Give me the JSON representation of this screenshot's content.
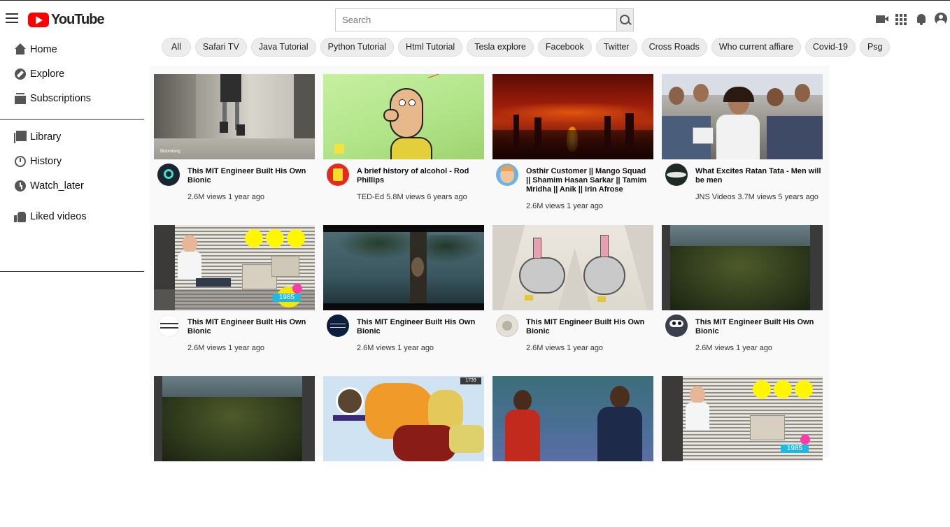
{
  "header": {
    "logo_text": "YouTube",
    "search_placeholder": "Search"
  },
  "sidebar": {
    "items": [
      {
        "label": "Home",
        "icon": "home-icon"
      },
      {
        "label": "Explore",
        "icon": "explore-icon"
      },
      {
        "label": "Subscriptions",
        "icon": "subscriptions-icon"
      },
      {
        "label": "Library",
        "icon": "library-icon"
      },
      {
        "label": "History",
        "icon": "history-icon"
      },
      {
        "label": "Watch_later",
        "icon": "watch-later-icon"
      },
      {
        "label": "Liked videos",
        "icon": "liked-videos-icon"
      }
    ]
  },
  "chips": [
    "All",
    "Safari TV",
    "Java Tutorial",
    "Python Tutorial",
    "Html Tutorial",
    "Tesla explore",
    "Facebook",
    "Twitter",
    "Cross Roads",
    "Who current affiare",
    "Covid-19",
    "Psg"
  ],
  "videos": [
    {
      "title": "This MIT Engineer Built His Own Bionic",
      "stats": "2.6M views 1 year ago"
    },
    {
      "title": "A brief history of alcohol - Rod Phillips",
      "stats": "TED-Ed 5.8M views 6 years ago"
    },
    {
      "title": "Osthir Customer || Mango Squad || Shamim Hasan Sarkar || Tamim Mridha || Anik || Irin Afrose",
      "stats": "2.6M views 1 year ago"
    },
    {
      "title": "What Excites Ratan Tata - Men will be men",
      "stats": "JNS Videos 3.7M views 5 years ago"
    },
    {
      "title": "This MIT Engineer Built His Own Bionic",
      "stats": "2.6M views 1 year ago"
    },
    {
      "title": "This MIT Engineer Built His Own Bionic",
      "stats": "2.6M views 1 year ago"
    },
    {
      "title": "This MIT Engineer Built His Own Bionic",
      "stats": "2.6M views 1 year ago"
    },
    {
      "title": "This MIT Engineer Built His Own Bionic",
      "stats": "2.6M views 1 year ago"
    },
    {
      "title": "",
      "stats": ""
    },
    {
      "title": "",
      "stats": ""
    },
    {
      "title": "",
      "stats": ""
    },
    {
      "title": "",
      "stats": ""
    }
  ],
  "thumb_text": {
    "bloomberg": "Bloomberg",
    "year": "1985",
    "map_year": "1739"
  },
  "colors": {
    "brand": "#ff0000"
  }
}
